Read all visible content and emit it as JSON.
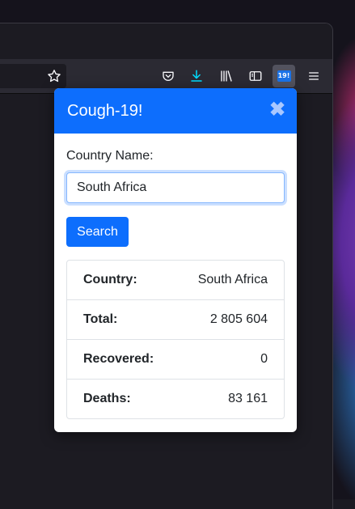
{
  "browser": {
    "toolbar_icons": [
      {
        "name": "bookmark-star-icon"
      },
      {
        "name": "pocket-icon"
      },
      {
        "name": "downloads-icon",
        "color": "#00ddff"
      },
      {
        "name": "library-icon"
      },
      {
        "name": "sidebar-icon"
      },
      {
        "name": "extension-icon",
        "label": "19!"
      },
      {
        "name": "menu-icon"
      }
    ]
  },
  "popup": {
    "title": "Cough-19!",
    "close_symbol": "✖",
    "form": {
      "label": "Country Name:",
      "value": "South Africa",
      "button_label": "Search"
    },
    "results": [
      {
        "key": "Country:",
        "value": "South Africa"
      },
      {
        "key": "Total:",
        "value": "2 805 604"
      },
      {
        "key": "Recovered:",
        "value": "0"
      },
      {
        "key": "Deaths:",
        "value": "83 161"
      }
    ],
    "colors": {
      "header": "#0d6efd",
      "button": "#0d6efd"
    }
  }
}
